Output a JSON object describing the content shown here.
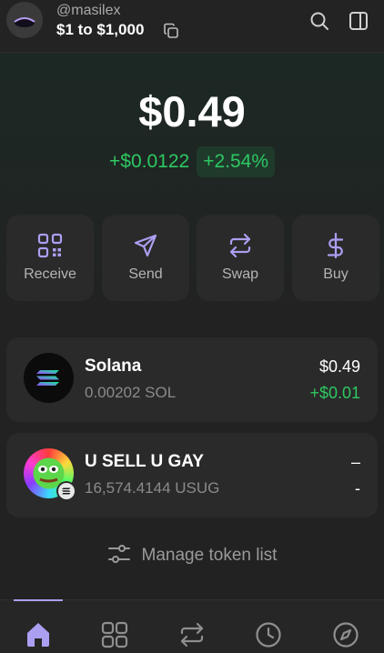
{
  "header": {
    "username": "@masilex",
    "wallet_name": "$1 to $1,000",
    "icons": [
      "avatar",
      "copy-icon",
      "search-icon",
      "sidebar-icon"
    ]
  },
  "balance": {
    "total": "$0.49",
    "change_amount": "+$0.0122",
    "change_percent": "+2.54%"
  },
  "actions": [
    {
      "label": "Receive",
      "icon": "qr-code-icon"
    },
    {
      "label": "Send",
      "icon": "send-icon"
    },
    {
      "label": "Swap",
      "icon": "swap-icon"
    },
    {
      "label": "Buy",
      "icon": "dollar-icon"
    }
  ],
  "tokens": [
    {
      "name": "Solana",
      "amount": "0.00202 SOL",
      "value": "$0.49",
      "change": "+$0.01"
    },
    {
      "name": "U SELL U GAY",
      "amount": "16,574.4144 USUG",
      "value": "–",
      "change": "-"
    }
  ],
  "manage": {
    "label": "Manage token list"
  },
  "nav": {
    "items": [
      "home-icon",
      "collectibles-icon",
      "swap-icon",
      "activity-icon",
      "explore-icon"
    ],
    "active": "home-icon"
  },
  "colors": {
    "accent": "#ab9ff2",
    "positive": "#2ec862",
    "background": "#222222",
    "card": "#2a2a2a"
  }
}
